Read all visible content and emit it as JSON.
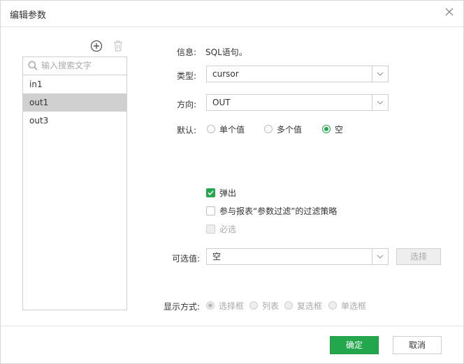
{
  "dialog": {
    "title": "编辑参数"
  },
  "params": {
    "search_placeholder": "输入搜索文字",
    "items": [
      {
        "label": "in1",
        "selected": false
      },
      {
        "label": "out1",
        "selected": true
      },
      {
        "label": "out3",
        "selected": false
      }
    ]
  },
  "form": {
    "info_label": "信息:",
    "info_value": "SQL语句。",
    "type_label": "类型:",
    "type_value": "cursor",
    "direction_label": "方向:",
    "direction_value": "OUT",
    "default_label": "默认:",
    "default_options": [
      "单个值",
      "多个值",
      "空"
    ],
    "default_selected": "空",
    "popup_label": "弹出",
    "popup_checked": true,
    "filter_label": "参与报表“参数过滤”的过滤策略",
    "filter_checked": false,
    "required_label": "必选",
    "required_checked": false,
    "optional_label": "可选值:",
    "optional_value": "空",
    "choose_button": "选择",
    "display_label": "显示方式:",
    "display_options": [
      "选择框",
      "列表",
      "复选框",
      "单选框"
    ],
    "display_selected": "选择框"
  },
  "footer": {
    "ok": "确定",
    "cancel": "取消"
  },
  "colors": {
    "accent": "#22a74c",
    "selected_row": "#d0d0d0",
    "border": "#cfcfcf"
  }
}
